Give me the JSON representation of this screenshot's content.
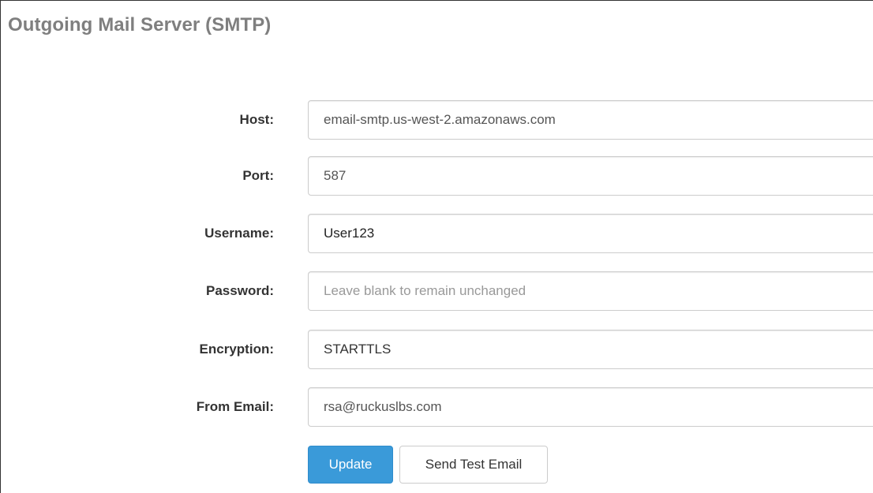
{
  "panel": {
    "title": "Outgoing Mail Server (SMTP)"
  },
  "fields": {
    "host": {
      "label": "Host:",
      "value": "email-smtp.us-west-2.amazonaws.com"
    },
    "port": {
      "label": "Port:",
      "value": "587"
    },
    "username": {
      "label": "Username:",
      "value": "User123"
    },
    "password": {
      "label": "Password:",
      "value": "",
      "placeholder": "Leave blank to remain unchanged"
    },
    "encryption": {
      "label": "Encryption:",
      "value": "STARTTLS"
    },
    "from_email": {
      "label": "From Email:",
      "value": "rsa@ruckuslbs.com"
    }
  },
  "buttons": {
    "update": "Update",
    "send_test": "Send Test Email"
  },
  "colors": {
    "primary": "#3a9ad9",
    "title": "#7f7f7f"
  }
}
